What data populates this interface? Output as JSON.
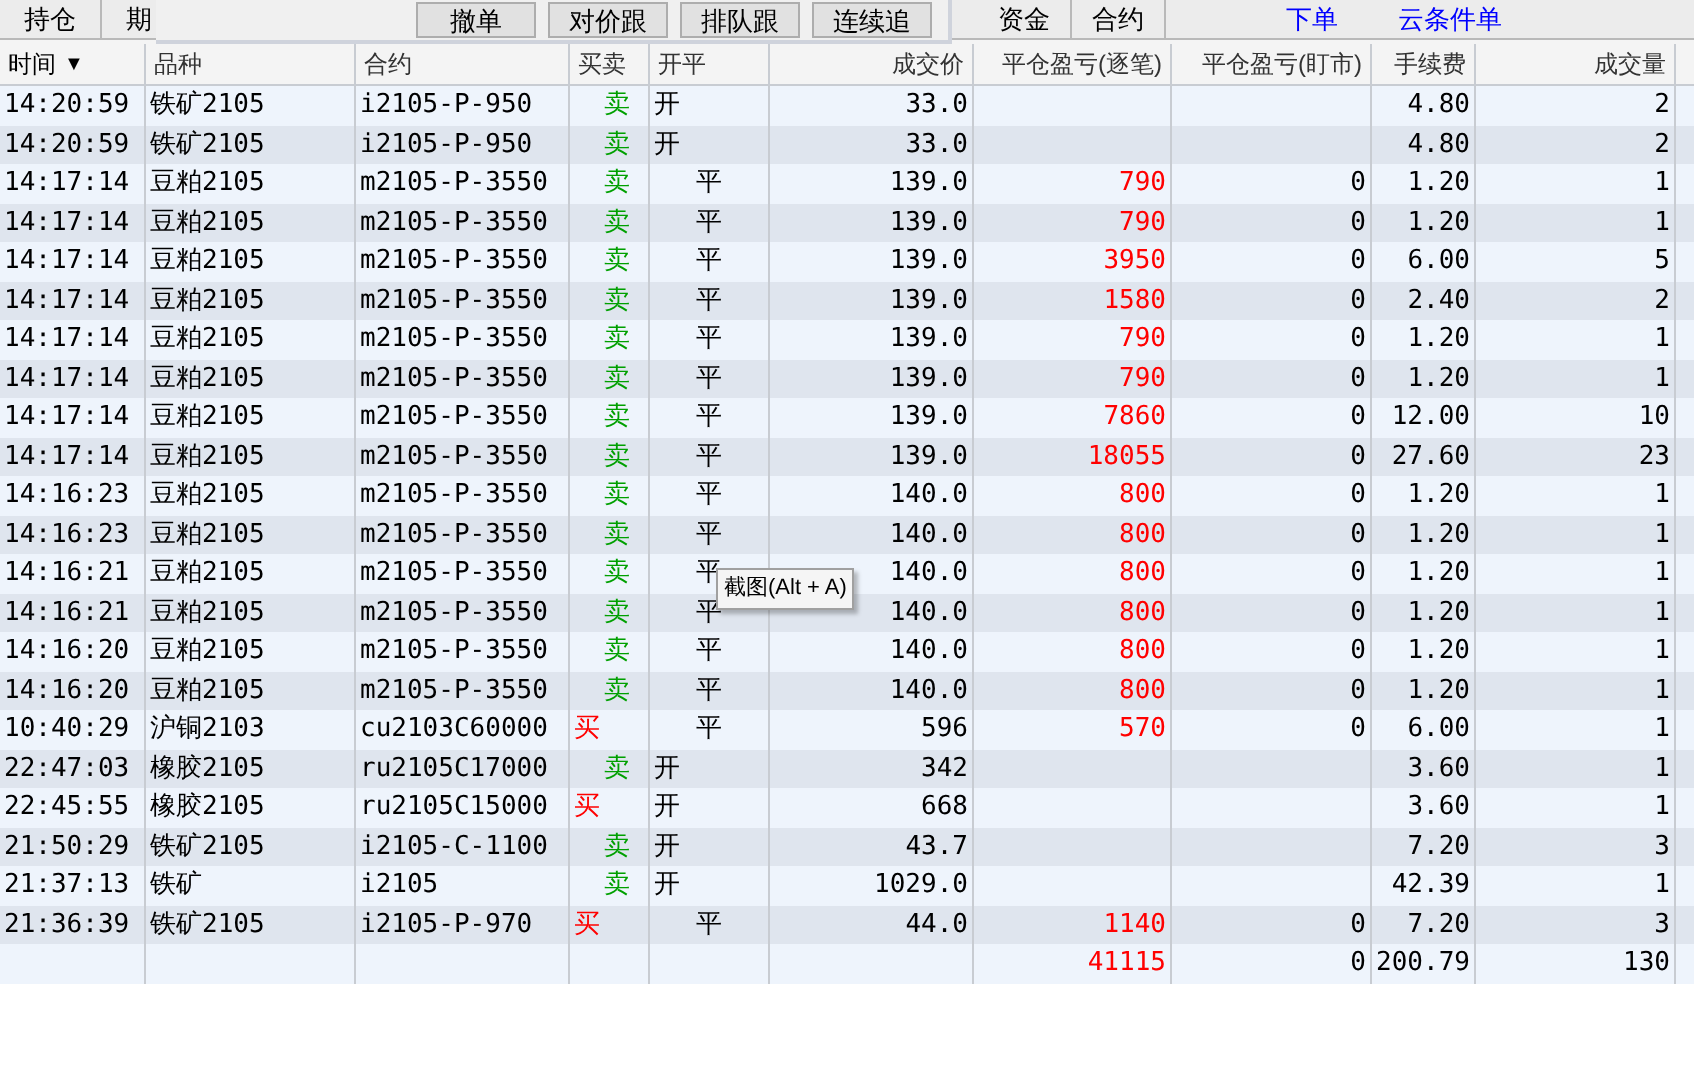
{
  "tabs_left": [
    {
      "label": "持仓",
      "selected": false
    },
    {
      "label": "期",
      "selected": false
    }
  ],
  "tabs_right": [
    {
      "label": "资金",
      "selected": false
    },
    {
      "label": "合约",
      "selected": false
    }
  ],
  "links": [
    "下单",
    "云条件单"
  ],
  "popup": {
    "buttons": [
      "撤单",
      "对价跟",
      "排队跟",
      "连续追"
    ]
  },
  "table": {
    "columns": [
      {
        "label": "时间",
        "sorted": true
      },
      {
        "label": "品种",
        "sorted": false
      },
      {
        "label": "合约",
        "sorted": false
      },
      {
        "label": "买卖",
        "sorted": false
      },
      {
        "label": "开平",
        "sorted": false
      },
      {
        "label": "成交价",
        "sorted": false
      },
      {
        "label": "平仓盈亏(逐笔)",
        "sorted": false
      },
      {
        "label": "平仓盈亏(盯市)",
        "sorted": false
      },
      {
        "label": "手续费",
        "sorted": false
      },
      {
        "label": "成交量",
        "sorted": false
      }
    ],
    "sort_mark": "▼",
    "rows": [
      {
        "time": "14:20:59",
        "product": "铁矿2105",
        "contract": "i2105-P-950",
        "side": {
          "text": "卖",
          "kind": "sell"
        },
        "offset": {
          "text": "开",
          "kind": "open"
        },
        "price": "33.0",
        "pnl": "",
        "mtm": "",
        "fee": "4.80",
        "qty": "2"
      },
      {
        "time": "14:20:59",
        "product": "铁矿2105",
        "contract": "i2105-P-950",
        "side": {
          "text": "卖",
          "kind": "sell"
        },
        "offset": {
          "text": "开",
          "kind": "open"
        },
        "price": "33.0",
        "pnl": "",
        "mtm": "",
        "fee": "4.80",
        "qty": "2"
      },
      {
        "time": "14:17:14",
        "product": "豆粕2105",
        "contract": "m2105-P-3550",
        "side": {
          "text": "卖",
          "kind": "sell"
        },
        "offset": {
          "text": "平",
          "kind": "close"
        },
        "price": "139.0",
        "pnl": "790",
        "mtm": "0",
        "fee": "1.20",
        "qty": "1"
      },
      {
        "time": "14:17:14",
        "product": "豆粕2105",
        "contract": "m2105-P-3550",
        "side": {
          "text": "卖",
          "kind": "sell"
        },
        "offset": {
          "text": "平",
          "kind": "close"
        },
        "price": "139.0",
        "pnl": "790",
        "mtm": "0",
        "fee": "1.20",
        "qty": "1"
      },
      {
        "time": "14:17:14",
        "product": "豆粕2105",
        "contract": "m2105-P-3550",
        "side": {
          "text": "卖",
          "kind": "sell"
        },
        "offset": {
          "text": "平",
          "kind": "close"
        },
        "price": "139.0",
        "pnl": "3950",
        "mtm": "0",
        "fee": "6.00",
        "qty": "5"
      },
      {
        "time": "14:17:14",
        "product": "豆粕2105",
        "contract": "m2105-P-3550",
        "side": {
          "text": "卖",
          "kind": "sell"
        },
        "offset": {
          "text": "平",
          "kind": "close"
        },
        "price": "139.0",
        "pnl": "1580",
        "mtm": "0",
        "fee": "2.40",
        "qty": "2"
      },
      {
        "time": "14:17:14",
        "product": "豆粕2105",
        "contract": "m2105-P-3550",
        "side": {
          "text": "卖",
          "kind": "sell"
        },
        "offset": {
          "text": "平",
          "kind": "close"
        },
        "price": "139.0",
        "pnl": "790",
        "mtm": "0",
        "fee": "1.20",
        "qty": "1"
      },
      {
        "time": "14:17:14",
        "product": "豆粕2105",
        "contract": "m2105-P-3550",
        "side": {
          "text": "卖",
          "kind": "sell"
        },
        "offset": {
          "text": "平",
          "kind": "close"
        },
        "price": "139.0",
        "pnl": "790",
        "mtm": "0",
        "fee": "1.20",
        "qty": "1"
      },
      {
        "time": "14:17:14",
        "product": "豆粕2105",
        "contract": "m2105-P-3550",
        "side": {
          "text": "卖",
          "kind": "sell"
        },
        "offset": {
          "text": "平",
          "kind": "close"
        },
        "price": "139.0",
        "pnl": "7860",
        "mtm": "0",
        "fee": "12.00",
        "qty": "10"
      },
      {
        "time": "14:17:14",
        "product": "豆粕2105",
        "contract": "m2105-P-3550",
        "side": {
          "text": "卖",
          "kind": "sell"
        },
        "offset": {
          "text": "平",
          "kind": "close"
        },
        "price": "139.0",
        "pnl": "18055",
        "mtm": "0",
        "fee": "27.60",
        "qty": "23"
      },
      {
        "time": "14:16:23",
        "product": "豆粕2105",
        "contract": "m2105-P-3550",
        "side": {
          "text": "卖",
          "kind": "sell"
        },
        "offset": {
          "text": "平",
          "kind": "close"
        },
        "price": "140.0",
        "pnl": "800",
        "mtm": "0",
        "fee": "1.20",
        "qty": "1"
      },
      {
        "time": "14:16:23",
        "product": "豆粕2105",
        "contract": "m2105-P-3550",
        "side": {
          "text": "卖",
          "kind": "sell"
        },
        "offset": {
          "text": "平",
          "kind": "close"
        },
        "price": "140.0",
        "pnl": "800",
        "mtm": "0",
        "fee": "1.20",
        "qty": "1"
      },
      {
        "time": "14:16:21",
        "product": "豆粕2105",
        "contract": "m2105-P-3550",
        "side": {
          "text": "卖",
          "kind": "sell"
        },
        "offset": {
          "text": "平",
          "kind": "close"
        },
        "price": "140.0",
        "pnl": "800",
        "mtm": "0",
        "fee": "1.20",
        "qty": "1"
      },
      {
        "time": "14:16:21",
        "product": "豆粕2105",
        "contract": "m2105-P-3550",
        "side": {
          "text": "卖",
          "kind": "sell"
        },
        "offset": {
          "text": "平",
          "kind": "close"
        },
        "price": "140.0",
        "pnl": "800",
        "mtm": "0",
        "fee": "1.20",
        "qty": "1"
      },
      {
        "time": "14:16:20",
        "product": "豆粕2105",
        "contract": "m2105-P-3550",
        "side": {
          "text": "卖",
          "kind": "sell"
        },
        "offset": {
          "text": "平",
          "kind": "close"
        },
        "price": "140.0",
        "pnl": "800",
        "mtm": "0",
        "fee": "1.20",
        "qty": "1"
      },
      {
        "time": "14:16:20",
        "product": "豆粕2105",
        "contract": "m2105-P-3550",
        "side": {
          "text": "卖",
          "kind": "sell"
        },
        "offset": {
          "text": "平",
          "kind": "close"
        },
        "price": "140.0",
        "pnl": "800",
        "mtm": "0",
        "fee": "1.20",
        "qty": "1"
      },
      {
        "time": "10:40:29",
        "product": "沪铜2103",
        "contract": "cu2103C60000",
        "side": {
          "text": "买",
          "kind": "buy"
        },
        "offset": {
          "text": "平",
          "kind": "close"
        },
        "price": "596",
        "pnl": "570",
        "mtm": "0",
        "fee": "6.00",
        "qty": "1"
      },
      {
        "time": "22:47:03",
        "product": "橡胶2105",
        "contract": "ru2105C17000",
        "side": {
          "text": "卖",
          "kind": "sell"
        },
        "offset": {
          "text": "开",
          "kind": "open"
        },
        "price": "342",
        "pnl": "",
        "mtm": "",
        "fee": "3.60",
        "qty": "1"
      },
      {
        "time": "22:45:55",
        "product": "橡胶2105",
        "contract": "ru2105C15000",
        "side": {
          "text": "买",
          "kind": "buy"
        },
        "offset": {
          "text": "开",
          "kind": "open"
        },
        "price": "668",
        "pnl": "",
        "mtm": "",
        "fee": "3.60",
        "qty": "1"
      },
      {
        "time": "21:50:29",
        "product": "铁矿2105",
        "contract": "i2105-C-1100",
        "side": {
          "text": "卖",
          "kind": "sell"
        },
        "offset": {
          "text": "开",
          "kind": "open"
        },
        "price": "43.7",
        "pnl": "",
        "mtm": "",
        "fee": "7.20",
        "qty": "3"
      },
      {
        "time": "21:37:13",
        "product": "铁矿",
        "contract": "i2105",
        "side": {
          "text": "卖",
          "kind": "sell"
        },
        "offset": {
          "text": "开",
          "kind": "open"
        },
        "price": "1029.0",
        "pnl": "",
        "mtm": "",
        "fee": "42.39",
        "qty": "1"
      },
      {
        "time": "21:36:39",
        "product": "铁矿2105",
        "contract": "i2105-P-970",
        "side": {
          "text": "买",
          "kind": "buy"
        },
        "offset": {
          "text": "平",
          "kind": "close"
        },
        "price": "44.0",
        "pnl": "1140",
        "mtm": "0",
        "fee": "7.20",
        "qty": "3"
      }
    ],
    "totals": {
      "pnl": "41115",
      "mtm": "0",
      "fee": "200.79",
      "qty": "130"
    }
  },
  "tooltip": "截图(Alt + A)"
}
